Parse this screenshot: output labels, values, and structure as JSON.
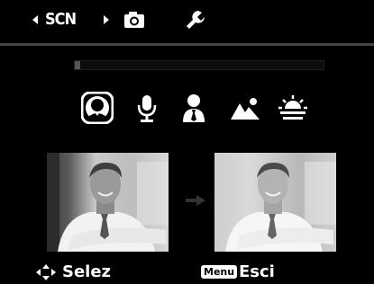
{
  "topbar": {
    "mode_label": "SCN",
    "tabs": [
      "camera-icon",
      "wrench-icon"
    ]
  },
  "scroll_bar": {
    "position_fraction": 0.02
  },
  "scenes": {
    "selected_index": 0,
    "items": [
      "portrait-icon",
      "microphone-icon",
      "person-tie-icon",
      "landscape-icon",
      "sunset-icon"
    ]
  },
  "preview": {
    "before_label": "",
    "after_label": ""
  },
  "bottombar": {
    "select_label": "Selez",
    "menu_key": "Menu",
    "exit_label": "Esci"
  },
  "colors": {
    "background": "#000000",
    "foreground": "#ffffff",
    "topline": "#444444"
  }
}
